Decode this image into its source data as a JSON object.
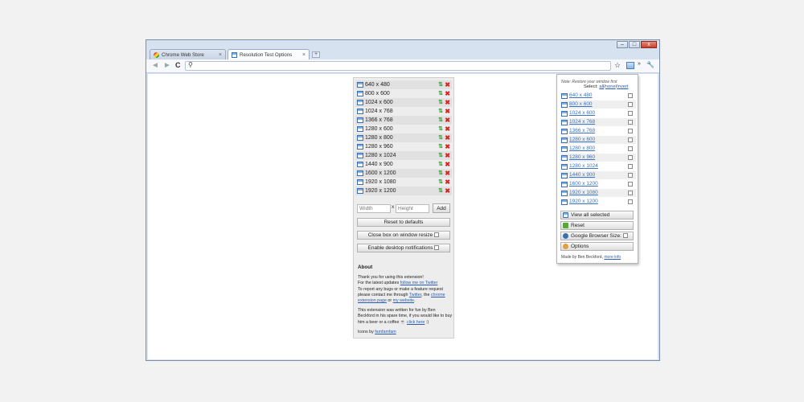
{
  "browser": {
    "tabs": [
      {
        "label": "Chrome Web Store"
      },
      {
        "label": "Resolution Test Options"
      }
    ],
    "tab_close": "×",
    "new_tab": "+",
    "address": "",
    "nav": {
      "back": "◄",
      "forward": "►",
      "reload": "C"
    },
    "toolbar_icons": {
      "star": "☆",
      "overflow": "»",
      "wrench": "🔧"
    },
    "window_controls": {
      "minimize": "–",
      "maximize": "□",
      "close": "x"
    }
  },
  "options": {
    "resolutions": [
      "640 x 480",
      "800 x 600",
      "1024 x 600",
      "1024 x 768",
      "1366 x 768",
      "1280 x 600",
      "1280 x 800",
      "1280 x 960",
      "1280 x 1024",
      "1440 x 900",
      "1600 x 1200",
      "1920 x 1080",
      "1920 x 1200"
    ],
    "move_glyph": "⇅",
    "delete_glyph": "✖",
    "width_placeholder": "Width",
    "height_placeholder": "Height",
    "x_label": "x",
    "add_label": "Add",
    "reset_label": "Reset to defaults",
    "close_box_label": "Close box on window resize",
    "notifications_label": "Enable desktop notifications",
    "about": {
      "heading": "About",
      "line1": "Thank you for using this extension!",
      "line2_prefix": "For the latest updates ",
      "line2_link": "follow me on Twitter",
      "line3_prefix": "To report any bugs or make a feature request please contact me through ",
      "line3_link1": "Twitter",
      "line3_mid": ", the ",
      "line3_link2": "chrome extension page",
      "line3_or": " or ",
      "line3_link3": "my website",
      "line3_end": ".",
      "line4": "This extension was written for fun by Ben Beckford in his spare time, if you would like to buy him a beer or a coffee ",
      "line4_link": "click here",
      "line4_end": " :)",
      "icons_prefix": "Icons by ",
      "icons_link": "famfamfam"
    }
  },
  "popup": {
    "note": "Note: Restore your window first",
    "select_label": "Select: ",
    "select_all": "all",
    "select_none": "none",
    "select_invert": "invert",
    "resolutions": [
      "640 x 480",
      "800 x 600",
      "1024 x 600",
      "1024 x 768",
      "1366 x 768",
      "1280 x 600",
      "1280 x 800",
      "1280 x 960",
      "1280 x 1024",
      "1440 x 900",
      "1600 x 1200",
      "1920 x 1080",
      "1920 x 1200"
    ],
    "view_all_label": "View all selected",
    "reset_label": "Reset",
    "google_size_label": "Google Browser Size:",
    "options_label": "Options",
    "footer_prefix": "Made by Ben Beckford, ",
    "footer_link": "more info"
  }
}
